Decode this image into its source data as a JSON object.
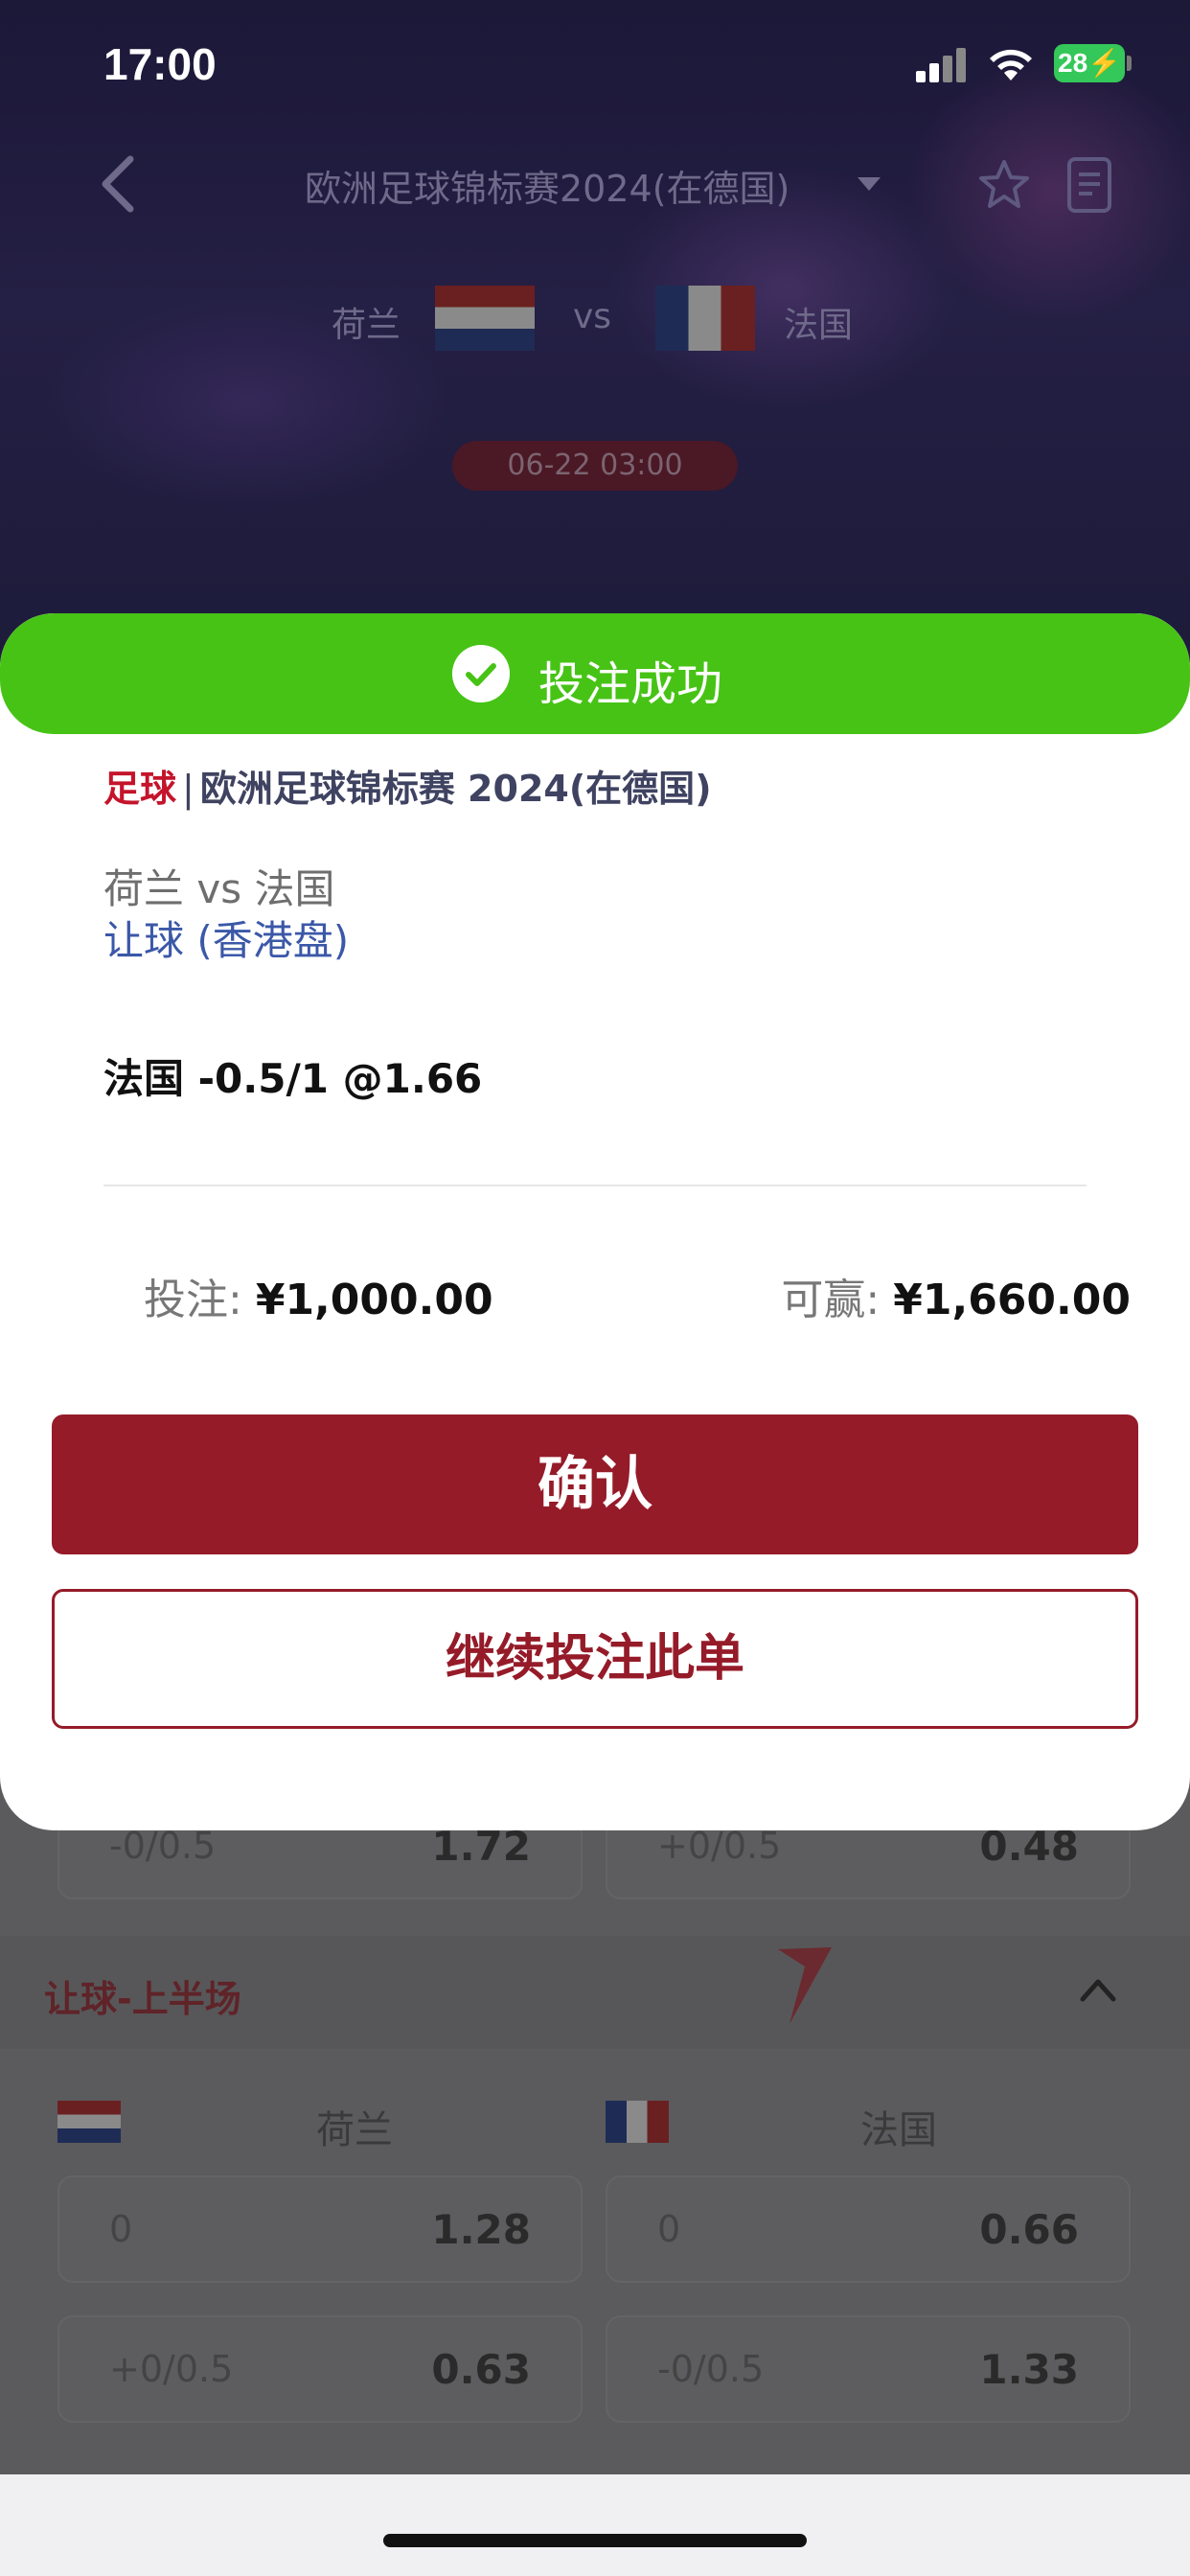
{
  "status_bar": {
    "time": "17:00",
    "battery": "28"
  },
  "header": {
    "title": "欧洲足球锦标赛2024(在德国)",
    "home_team": "荷兰",
    "vs": "vs",
    "away_team": "法国",
    "match_time": "06-22 03:00"
  },
  "background_market": {
    "top_row": [
      {
        "line": "-0/0.5",
        "odds": "1.72"
      },
      {
        "line": "+0/0.5",
        "odds": "0.48"
      }
    ],
    "section_title": "让球-上半场",
    "columns": [
      "荷兰",
      "法国"
    ],
    "rows": [
      [
        {
          "line": "0",
          "odds": "1.28"
        },
        {
          "line": "0",
          "odds": "0.66"
        }
      ],
      [
        {
          "line": "+0/0.5",
          "odds": "0.63"
        },
        {
          "line": "-0/0.5",
          "odds": "1.33"
        }
      ]
    ]
  },
  "modal": {
    "banner": "投注成功",
    "sport": "足球",
    "separator": "|",
    "league": "欧洲足球锦标赛 2024(在德国)",
    "match": "荷兰 vs 法国",
    "market": "让球 (香港盘)",
    "selection": "法国 -0.5/1 @1.66",
    "stake_label": "投注:",
    "stake_value": "¥1,000.00",
    "win_label": "可赢:",
    "win_value": "¥1,660.00",
    "confirm_label": "确认",
    "continue_label": "继续投注此单"
  },
  "colors": {
    "success": "#47c316",
    "primary": "#951b29",
    "sport_red": "#c4142b",
    "market_blue": "#3b58a8"
  }
}
